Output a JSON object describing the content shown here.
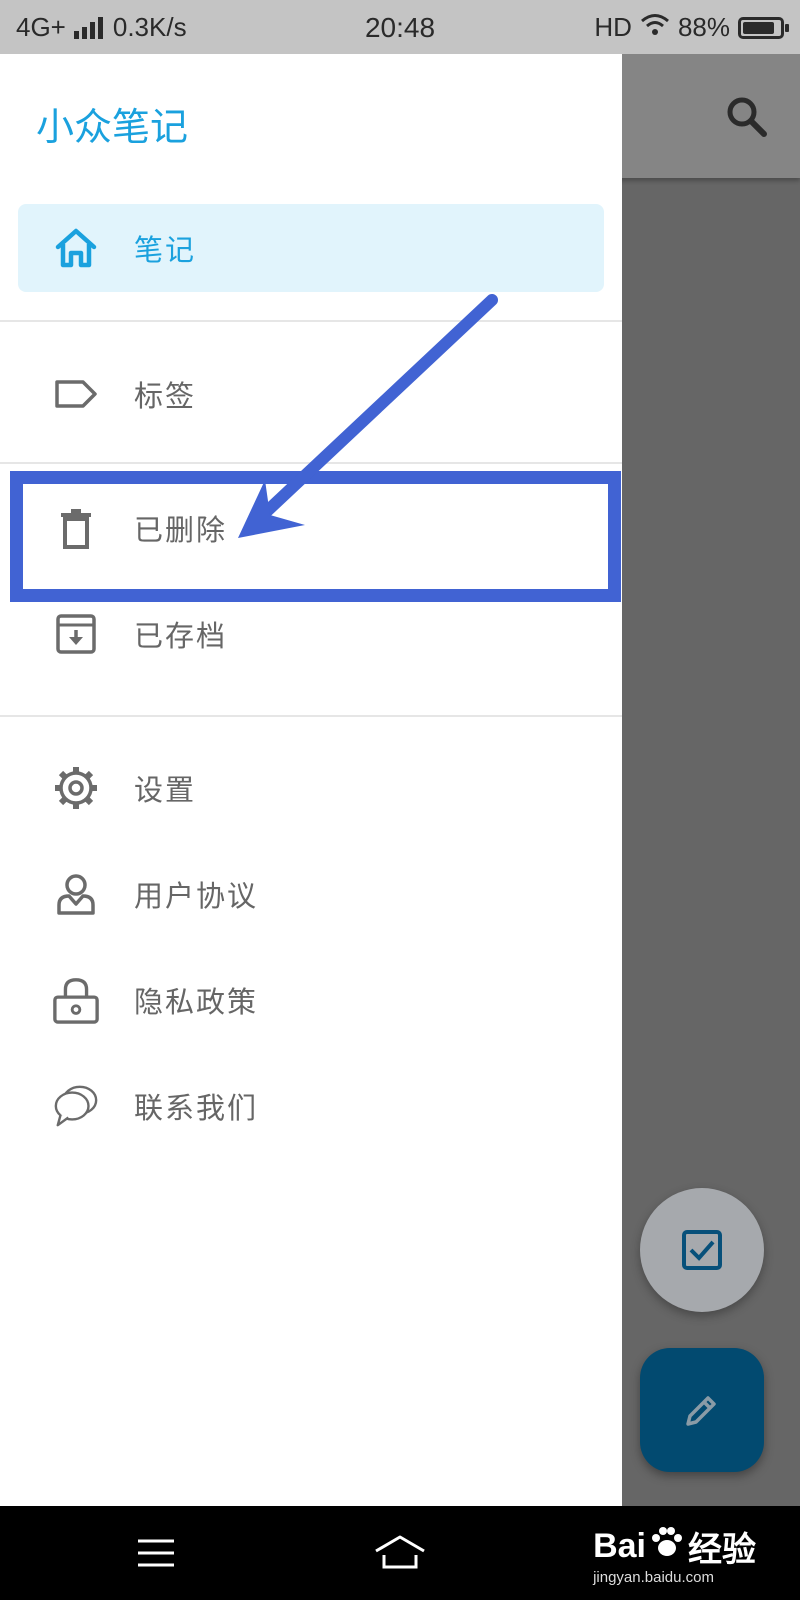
{
  "status_bar": {
    "network": "4G+",
    "speed": "0.3K/s",
    "time": "20:48",
    "hd": "HD",
    "battery": "88%",
    "battery_level": 0.88
  },
  "drawer": {
    "title": "小众笔记",
    "items": [
      {
        "label": "笔记",
        "icon": "home-icon",
        "active": true
      },
      {
        "label": "标签",
        "icon": "tag-icon"
      },
      {
        "label": "已删除",
        "icon": "trash-icon"
      },
      {
        "label": "已存档",
        "icon": "archive-icon"
      },
      {
        "label": "设置",
        "icon": "gear-icon"
      },
      {
        "label": "用户协议",
        "icon": "user-icon"
      },
      {
        "label": "隐私政策",
        "icon": "lock-icon"
      },
      {
        "label": "联系我们",
        "icon": "chat-bubbles-icon"
      }
    ]
  },
  "app": {
    "search_icon": "search-icon",
    "fab_check_icon": "checkbox-icon",
    "fab_edit_icon": "pencil-icon"
  },
  "colors": {
    "accent": "#1aa1de",
    "active_bg": "#e1f4fc",
    "annotation": "#4163d3",
    "fab_dark": "#024a70"
  },
  "nav_bar": {
    "menu_icon": "menu-icon",
    "home_icon": "home-outline-icon"
  },
  "watermark": {
    "brand": "Bai",
    "brand_suffix": "经验",
    "url": "jingyan.baidu.com"
  }
}
